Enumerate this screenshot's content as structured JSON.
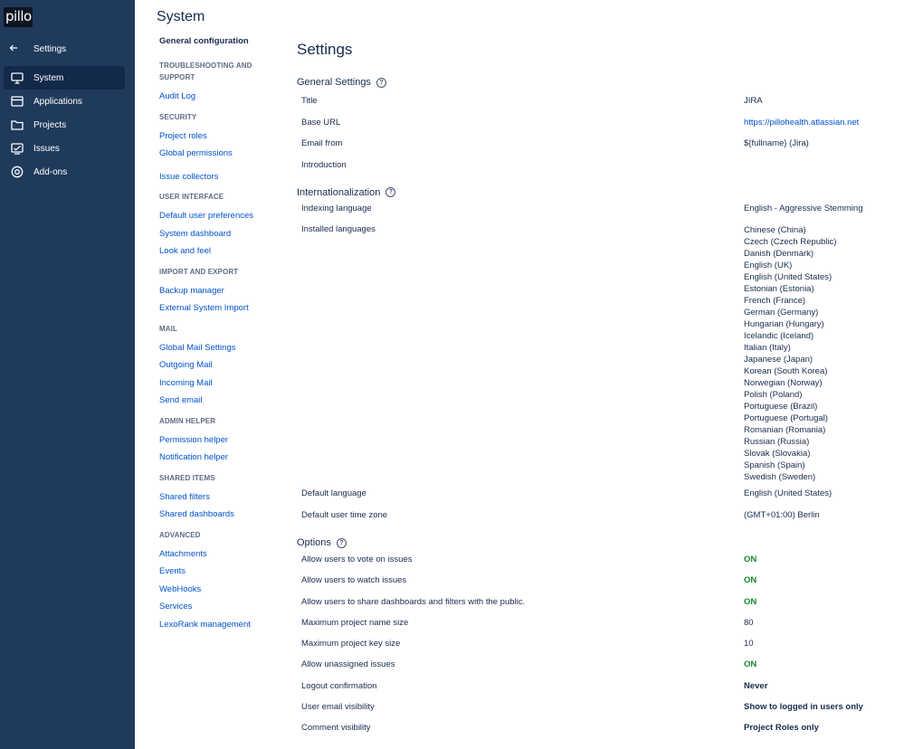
{
  "app": {
    "logo_text": "pillo"
  },
  "sidebar": {
    "back_label": "Settings",
    "items": [
      {
        "label": "System",
        "icon": "monitor-icon",
        "active": true
      },
      {
        "label": "Applications",
        "icon": "applications-icon",
        "active": false
      },
      {
        "label": "Projects",
        "icon": "folder-icon",
        "active": false
      },
      {
        "label": "Issues",
        "icon": "issues-icon",
        "active": false
      },
      {
        "label": "Add-ons",
        "icon": "addons-icon",
        "active": false
      }
    ]
  },
  "header": {
    "title": "System"
  },
  "subnav": {
    "current": "General configuration",
    "groups": [
      {
        "title": "TROUBLESHOOTING AND SUPPORT",
        "links": [
          "Audit Log"
        ]
      },
      {
        "title": "SECURITY",
        "links": [
          "Project roles",
          "Global permissions",
          "Issue collectors"
        ]
      },
      {
        "title": "USER INTERFACE",
        "links": [
          "Default user preferences",
          "System dashboard",
          "Look and feel"
        ]
      },
      {
        "title": "IMPORT AND EXPORT",
        "links": [
          "Backup manager",
          "External System Import"
        ]
      },
      {
        "title": "MAIL",
        "links": [
          "Global Mail Settings",
          "Outgoing Mail",
          "Incoming Mail",
          "Send email"
        ]
      },
      {
        "title": "ADMIN HELPER",
        "links": [
          "Permission helper",
          "Notification helper"
        ]
      },
      {
        "title": "SHARED ITEMS",
        "links": [
          "Shared filters",
          "Shared dashboards"
        ]
      },
      {
        "title": "ADVANCED",
        "links": [
          "Attachments",
          "Events",
          "WebHooks",
          "Services",
          "LexoRank management"
        ]
      }
    ]
  },
  "main": {
    "title": "Settings",
    "general": {
      "heading": "General Settings",
      "title_label": "Title",
      "title_value": "JIRA",
      "base_url_label": "Base URL",
      "base_url_value": "https://pillohealth.atlassian.net",
      "email_from_label": "Email from",
      "email_from_value": "${fullname} (Jira)",
      "introduction_label": "Introduction",
      "introduction_value": ""
    },
    "i18n": {
      "heading": "Internationalization",
      "indexing_label": "Indexing language",
      "indexing_value": "English - Aggressive Stemming",
      "installed_label": "Installed languages",
      "installed": [
        "Chinese (China)",
        "Czech (Czech Republic)",
        "Danish (Denmark)",
        "English (UK)",
        "English (United States)",
        "Estonian (Estonia)",
        "French (France)",
        "German (Germany)",
        "Hungarian (Hungary)",
        "Icelandic (Iceland)",
        "Italian (Italy)",
        "Japanese (Japan)",
        "Korean (South Korea)",
        "Norwegian (Norway)",
        "Polish (Poland)",
        "Portuguese (Brazil)",
        "Portuguese (Portugal)",
        "Romanian (Romania)",
        "Russian (Russia)",
        "Slovak (Slovakia)",
        "Spanish (Spain)",
        "Swedish (Sweden)"
      ],
      "default_lang_label": "Default language",
      "default_lang_value": "English (United States)",
      "timezone_label": "Default user time zone",
      "timezone_value": "(GMT+01:00) Berlin"
    },
    "options": {
      "heading": "Options",
      "rows": [
        {
          "label": "Allow users to vote on issues",
          "value": "ON",
          "style": "on"
        },
        {
          "label": "Allow users to watch issues",
          "value": "ON",
          "style": "on"
        },
        {
          "label": "Allow users to share dashboards and filters with the public.",
          "value": "ON",
          "style": "on"
        },
        {
          "label": "Maximum project name size",
          "value": "80",
          "style": "plain"
        },
        {
          "label": "Maximum project key size",
          "value": "10",
          "style": "plain"
        },
        {
          "label": "Allow unassigned issues",
          "value": "ON",
          "style": "on"
        },
        {
          "label": "Logout confirmation",
          "value": "Never",
          "style": "bold"
        },
        {
          "label": "User email visibility",
          "value": "Show to logged in users only",
          "style": "bold"
        },
        {
          "label": "Comment visibility",
          "value": "Project Roles only",
          "style": "bold"
        }
      ]
    }
  },
  "colors": {
    "sidebar_bg": "#203a5c",
    "link": "#0052cc",
    "on": "#14892c"
  }
}
